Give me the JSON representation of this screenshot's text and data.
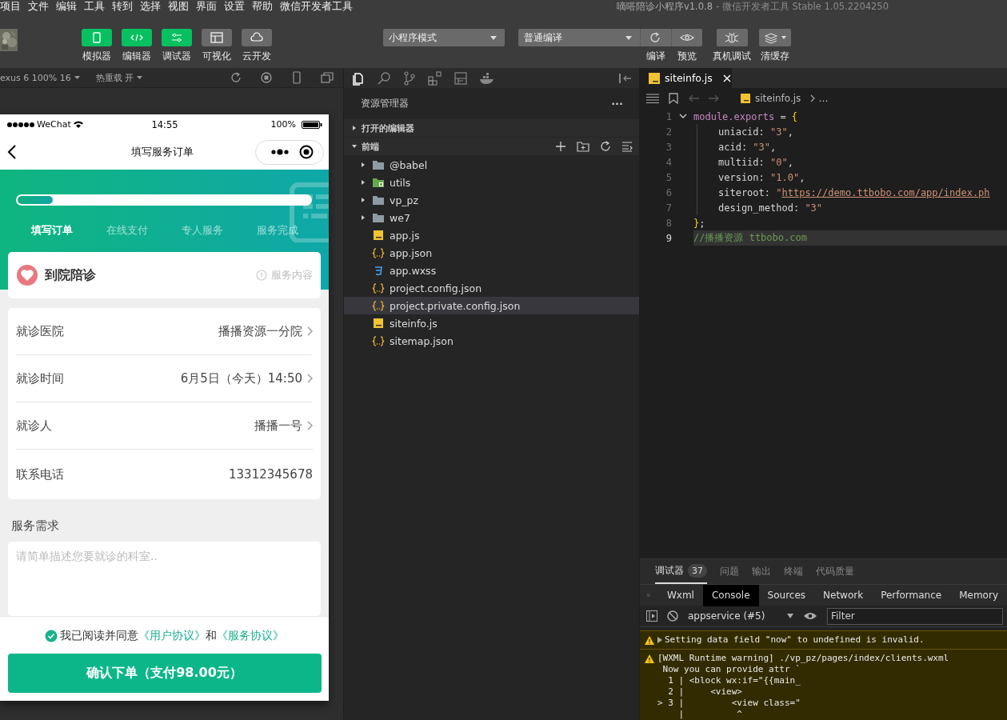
{
  "menu": [
    "项目",
    "文件",
    "编辑",
    "工具",
    "转到",
    "选择",
    "视图",
    "界面",
    "设置",
    "帮助",
    "微信开发者工具"
  ],
  "window": {
    "title": "嘀嗒陪诊小程序v1.0.8",
    "subtitle": "- 微信开发者工具 Stable 1.05.2204250"
  },
  "toolbar": {
    "views": [
      {
        "kind": "simulator",
        "label": "模拟器",
        "selected": true
      },
      {
        "kind": "editor",
        "label": "编辑器",
        "selected": true
      },
      {
        "kind": "debugger",
        "label": "调试器",
        "selected": true
      },
      {
        "kind": "visual",
        "label": "可视化",
        "selected": false
      },
      {
        "kind": "cloud",
        "label": "云开发",
        "selected": false
      }
    ],
    "mode_select": "小程序模式",
    "compile_select": "普通编译",
    "actions": [
      {
        "kind": "compile",
        "label": "编译"
      },
      {
        "kind": "preview",
        "label": "预览"
      },
      {
        "kind": "device",
        "label": "真机调试"
      },
      {
        "kind": "cache",
        "label": "清缓存"
      }
    ]
  },
  "simulator_bar": {
    "device": "exus 6 100% 16",
    "hot_reload": "热重载 开"
  },
  "phone": {
    "carrier": "WeChat",
    "time": "14:55",
    "battery": "100%",
    "nav_title": "填写服务订单",
    "progress": {
      "level": 0.12
    },
    "steps": [
      {
        "label": "填写订单",
        "selected": true
      },
      {
        "label": "在线支付",
        "selected": false
      },
      {
        "label": "专人服务",
        "selected": false
      },
      {
        "label": "服务完成",
        "selected": false
      }
    ],
    "service": {
      "name": "到院陪诊",
      "link": "服务内容"
    },
    "rows": [
      {
        "label": "就诊医院",
        "value": "播播资源一分院",
        "arrow": true
      },
      {
        "label": "就诊时间",
        "value": "6月5日（今天）14:50",
        "arrow": true
      },
      {
        "label": "就诊人",
        "value": "播播一号",
        "arrow": true
      },
      {
        "label": "联系电话",
        "value": "13312345678",
        "arrow": false
      }
    ],
    "needs_label": "服务需求",
    "needs": {
      "placeholder": "请简单描述您要就诊的科室.."
    },
    "agreement": {
      "checked": true,
      "text": "我已阅读并同意",
      "link_1": "《用户协议》",
      "joiner": "和",
      "link_2": "《服务协议》"
    },
    "submit": "确认下单（支付98.00元）"
  },
  "explorer": {
    "title": "资源管理器",
    "more": "···",
    "sections": [
      {
        "label": "打开的编辑器",
        "expanded": false
      },
      {
        "label": "前端",
        "expanded": true
      }
    ],
    "files": [
      {
        "name": "@babel",
        "kind": "folder",
        "selected": false
      },
      {
        "name": "utils",
        "kind": "package",
        "selected": false
      },
      {
        "name": "vp_pz",
        "kind": "folder",
        "selected": false
      },
      {
        "name": "we7",
        "kind": "folder",
        "selected": false
      },
      {
        "name": "app.js",
        "kind": "js",
        "selected": false
      },
      {
        "name": "app.json",
        "kind": "json",
        "selected": false
      },
      {
        "name": "app.wxss",
        "kind": "wxss",
        "selected": false
      },
      {
        "name": "project.config.json",
        "kind": "json",
        "selected": false
      },
      {
        "name": "project.private.config.json",
        "kind": "json",
        "selected": true
      },
      {
        "name": "siteinfo.js",
        "kind": "js",
        "selected": false
      },
      {
        "name": "sitemap.json",
        "kind": "json",
        "selected": false
      }
    ]
  },
  "editor": {
    "tab": "siteinfo.js",
    "breadcrumb": "siteinfo.js",
    "breadcrumb_more": "…",
    "lines": [
      {
        "number": "1",
        "current": false,
        "tokens": [
          {
            "kind": "keyword",
            "text": "module.exports"
          },
          {
            "kind": "plain",
            "text": " = "
          },
          {
            "kind": "brace",
            "text": "{"
          }
        ]
      },
      {
        "number": "2",
        "current": false,
        "tokens": [
          {
            "kind": "plain",
            "text": "uniacid: "
          },
          {
            "kind": "string",
            "text": "\"3\""
          },
          {
            "kind": "plain",
            "text": ","
          }
        ]
      },
      {
        "number": "3",
        "current": false,
        "tokens": [
          {
            "kind": "plain",
            "text": "acid: "
          },
          {
            "kind": "string",
            "text": "\"3\""
          },
          {
            "kind": "plain",
            "text": ","
          }
        ]
      },
      {
        "number": "4",
        "current": false,
        "tokens": [
          {
            "kind": "plain",
            "text": "multiid: "
          },
          {
            "kind": "string",
            "text": "\"0\""
          },
          {
            "kind": "plain",
            "text": ","
          }
        ]
      },
      {
        "number": "5",
        "current": false,
        "tokens": [
          {
            "kind": "plain",
            "text": "version: "
          },
          {
            "kind": "string",
            "text": "\"1.0\""
          },
          {
            "kind": "plain",
            "text": ","
          }
        ]
      },
      {
        "number": "6",
        "current": false,
        "tokens": [
          {
            "kind": "plain",
            "text": "siteroot: "
          },
          {
            "kind": "string",
            "text": "\""
          },
          {
            "kind": "link",
            "text": "https://demo.ttbobo.com/app/index.ph"
          }
        ]
      },
      {
        "number": "7",
        "current": false,
        "tokens": [
          {
            "kind": "plain",
            "text": "design_method: "
          },
          {
            "kind": "string",
            "text": "\"3\""
          }
        ]
      },
      {
        "number": "8",
        "current": false,
        "tokens": [
          {
            "kind": "brace",
            "text": "}"
          },
          {
            "kind": "plain",
            "text": ";"
          }
        ]
      },
      {
        "number": "9",
        "current": true,
        "tokens": [
          {
            "kind": "comment",
            "text": "//播播资源 ttbobo.com"
          }
        ]
      }
    ]
  },
  "devtools": {
    "tabs": [
      {
        "label": "调试器",
        "badge": "37",
        "selected": true
      },
      {
        "label": "问题",
        "selected": false
      },
      {
        "label": "输出",
        "selected": false
      },
      {
        "label": "终端",
        "selected": false
      },
      {
        "label": "代码质量",
        "selected": false
      }
    ],
    "panels": [
      {
        "label": "Wxml",
        "selected": false
      },
      {
        "label": "Console",
        "selected": true
      },
      {
        "label": "Sources",
        "selected": false
      },
      {
        "label": "Network",
        "selected": false
      },
      {
        "label": "Performance",
        "selected": false
      },
      {
        "label": "Memory",
        "selected": false
      }
    ],
    "context": "appservice (#5)",
    "filter": {
      "placeholder": "Filter"
    },
    "messages": [
      {
        "kind": "warning",
        "expandable": true,
        "lines": [
          "Setting data field \"now\" to undefined is invalid."
        ]
      },
      {
        "kind": "warning",
        "expandable": false,
        "lines": [
          "[WXML Runtime warning] ./vp_pz/pages/index/clients.wxml",
          " Now you can provide attr `",
          "  1 | <block wx:if=\"{{main_",
          "  2 |     <view>",
          "> 3 |         <view class=\"",
          "    |          ^"
        ]
      }
    ]
  }
}
